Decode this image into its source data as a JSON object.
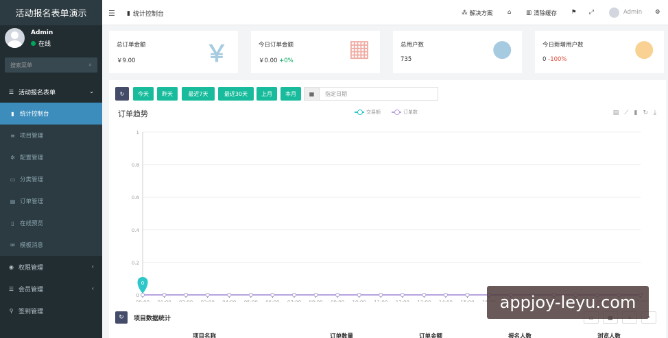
{
  "app": {
    "title": "活动报名表单演示"
  },
  "user": {
    "name": "Admin",
    "status": "在线"
  },
  "sidebar": {
    "search_placeholder": "搜索菜单",
    "items": [
      {
        "label": "活动报名表单",
        "icon": "list-icon"
      },
      {
        "label": "统计控制台",
        "icon": "bar-chart-icon"
      },
      {
        "label": "项目管理",
        "icon": "list-icon"
      },
      {
        "label": "配置管理",
        "icon": "gear-icon"
      },
      {
        "label": "分类管理",
        "icon": "folder-icon"
      },
      {
        "label": "订单管理",
        "icon": "file-icon"
      },
      {
        "label": "在线预览",
        "icon": "mobile-icon"
      },
      {
        "label": "模板消息",
        "icon": "envelope-icon"
      },
      {
        "label": "权限管理",
        "icon": "users-icon"
      },
      {
        "label": "会员管理",
        "icon": "list-icon"
      },
      {
        "label": "签到管理",
        "icon": "map-marker-icon"
      }
    ]
  },
  "topbar": {
    "tab": "统计控制台",
    "solution": "解决方案",
    "clear_cache": "清除缓存",
    "admin": "Admin"
  },
  "cards": [
    {
      "title": "总订单金额",
      "value": "￥9.00",
      "change": "",
      "icon_glyph": "￥",
      "color": "#3c8dbc"
    },
    {
      "title": "今日订单金额",
      "value": "￥0.00",
      "change": "+0%",
      "icon_glyph": "▦",
      "color": "#dd4b39"
    },
    {
      "title": "总用户数",
      "value": "735",
      "change": "",
      "icon_glyph": "●",
      "color": "#3c8dbc"
    },
    {
      "title": "今日新增用户数",
      "value": "0",
      "change": "-100%",
      "icon_glyph": "●",
      "color": "#f39c12"
    }
  ],
  "filters": {
    "buttons": [
      "今天",
      "昨天",
      "最近7天",
      "最近30天",
      "上月",
      "本月"
    ],
    "date_placeholder": "指定日期"
  },
  "chart_section": {
    "title": "订单趋势",
    "legend": [
      "交易额",
      "订单数"
    ]
  },
  "chart_data": {
    "type": "line",
    "x": [
      "00:00",
      "01:00",
      "02:00",
      "03:00",
      "04:00",
      "05:00",
      "06:00",
      "07:00",
      "08:00",
      "09:00",
      "10:00",
      "11:00",
      "12:00",
      "13:00",
      "14:00",
      "15:00",
      "16:00",
      "17:00",
      "18:00",
      "19:00",
      "20:00",
      "21:00",
      "22:00",
      "23:00"
    ],
    "series": [
      {
        "name": "交易额",
        "values": [
          0,
          0,
          0,
          0,
          0,
          0,
          0,
          0,
          0,
          0,
          0,
          0,
          0,
          0,
          0,
          0,
          0,
          0,
          0,
          0,
          0,
          0,
          0,
          0
        ]
      },
      {
        "name": "订单数",
        "values": [
          0,
          0,
          0,
          0,
          0,
          0,
          0,
          0,
          0,
          0,
          0,
          0,
          0,
          0,
          0,
          0,
          0,
          0,
          0,
          0,
          0,
          0,
          0,
          0
        ]
      }
    ],
    "yticks": [
      "0",
      "0.2",
      "0.4",
      "0.6",
      "0.8",
      "1"
    ],
    "ylim": [
      0,
      1
    ],
    "marker_label": "0"
  },
  "table_section": {
    "title": "项目数据统计",
    "columns": [
      "项目名称",
      "订单数量",
      "订单金额",
      "报名人数",
      "浏览人数"
    ]
  },
  "watermark": "appjoy-leyu.com"
}
